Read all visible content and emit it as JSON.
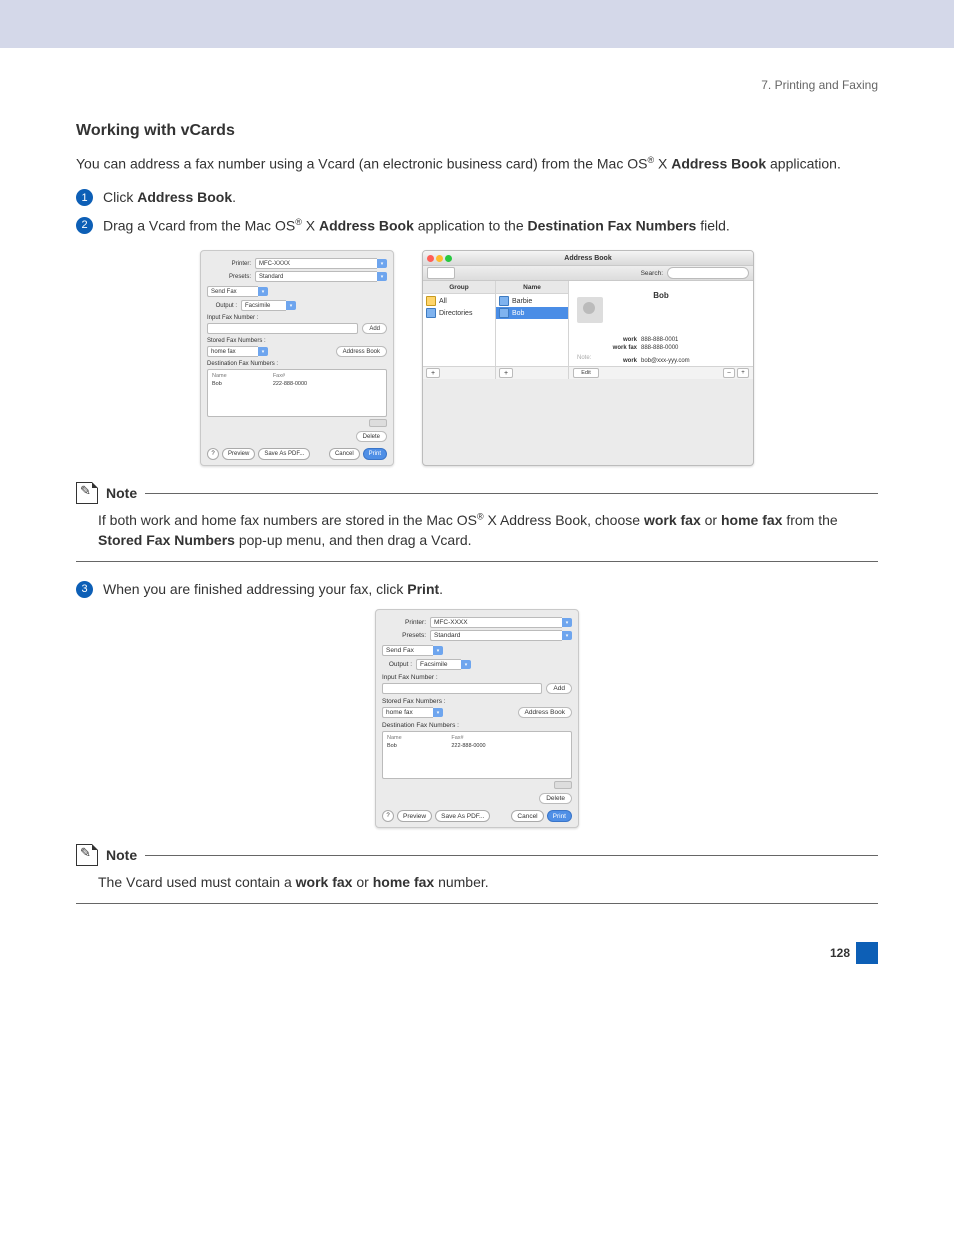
{
  "header": {
    "breadcrumb": "7. Printing and Faxing"
  },
  "section": {
    "title": "Working with vCards",
    "intro_pre": "You can address a fax number using a Vcard (an electronic business card) from the Mac OS",
    "intro_post": " X ",
    "intro_bold": "Address Book",
    "intro_tail": " application."
  },
  "steps": {
    "s1_pre": "Click ",
    "s1_bold": "Address Book",
    "s1_post": ".",
    "s2_pre": "Drag a Vcard from the Mac OS",
    "s2_mid": " X ",
    "s2_b1": "Address Book",
    "s2_mid2": " application to the ",
    "s2_b2": "Destination Fax Numbers",
    "s2_post": " field.",
    "s3_pre": "When you are finished addressing your fax, click ",
    "s3_bold": "Print",
    "s3_post": "."
  },
  "faxDialog": {
    "printer_label": "Printer:",
    "printer_value": "MFC-XXXX",
    "presets_label": "Presets:",
    "presets_value": "Standard",
    "panel": "Send Fax",
    "output_label": "Output :",
    "output_value": "Facsimile",
    "input_fax_label": "Input Fax Number :",
    "add_btn": "Add",
    "stored_label": "Stored Fax Numbers :",
    "stored_value": "home fax",
    "addrbook_btn": "Address Book",
    "dest_label": "Destination Fax Numbers :",
    "col_name": "Name",
    "col_fax": "Fax#",
    "row_name": "Bob",
    "row_fax": "222-888-0000",
    "delete_btn": "Delete",
    "preview_btn": "Preview",
    "saveas_btn": "Save As PDF...",
    "cancel_btn": "Cancel",
    "print_btn": "Print"
  },
  "addressBook": {
    "title": "Address Book",
    "search_label": "Search:",
    "col_group": "Group",
    "col_name": "Name",
    "groups": {
      "g1": "All",
      "g2": "Directories"
    },
    "names": {
      "n1": "Barbie",
      "n2": "Bob"
    },
    "card": {
      "name": "Bob",
      "work_label": "work",
      "work_val": "888-888-0001",
      "workfax_label": "work fax",
      "workfax_val": "888-888-0000",
      "email_label": "work",
      "email_val": "bob@xxx-yyy.com",
      "note_label": "Note:"
    },
    "edit_btn": "Edit"
  },
  "note1": {
    "title": "Note",
    "t1": "If both work and home fax numbers are stored in the Mac OS",
    "t2": " X Address Book, choose ",
    "b1": "work fax",
    "t3": " or ",
    "b2": "home fax",
    "t4": " from the ",
    "b3": "Stored Fax Numbers",
    "t5": " pop-up menu, and then drag a Vcard."
  },
  "note2": {
    "title": "Note",
    "t1": "The Vcard used must contain a ",
    "b1": "work fax",
    "t2": " or ",
    "b2": "home fax",
    "t3": " number."
  },
  "page_number": "128"
}
